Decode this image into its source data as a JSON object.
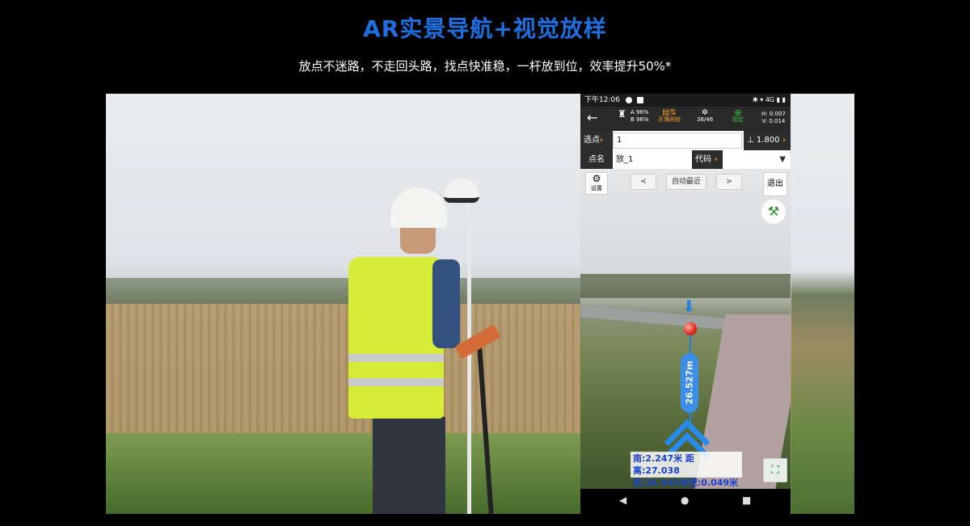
{
  "header": {
    "title": "AR实景导航+视觉放样",
    "subtitle": "放点不迷路，不走回头路，找点快准稳，一杆放到位，效率提升50%*"
  },
  "phone": {
    "status": {
      "time": "下午12:06",
      "right": "✱ ▾ 4G ▮ ▮"
    },
    "toolbar": {
      "back_icon": "arrow-left-icon",
      "quality_a": "A 96%",
      "quality_b": "B 96%",
      "network": "手簿网络",
      "satellites": "36/46",
      "fix": "固定",
      "h": "H: 0.007",
      "v": "V: 0.014"
    },
    "point_select": {
      "label": "选点",
      "value": "1",
      "height": "1.800"
    },
    "point_name": {
      "label": "点名",
      "value": "放_1",
      "code_label": "代码",
      "code_value": ""
    },
    "ar": {
      "settings": "设置",
      "prev": "<",
      "mode": "自动最近",
      "next": ">",
      "exit": "退出",
      "distance": "26.527m",
      "coord_line1": "南:2.247米  距离:27.038",
      "coord_line2": "西:26.945米挖:0.049米"
    },
    "navbar": {
      "back": "◀",
      "home": "●",
      "recents": "■"
    }
  },
  "colors": {
    "title": "#1f6fe0",
    "accent_orange": "#f29b2a",
    "ar_blue": "#2a7fe0",
    "target_red": "#e2231a"
  }
}
